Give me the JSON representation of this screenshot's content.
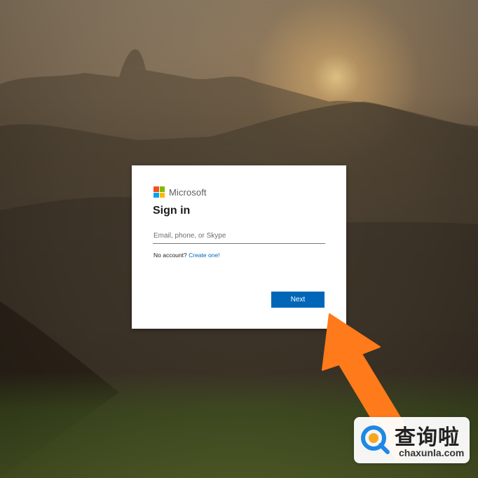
{
  "background": {
    "description_icon": "landscape-photo"
  },
  "dialog": {
    "brand": "Microsoft",
    "title": "Sign in",
    "input_placeholder": "Email, phone, or Skype",
    "input_value": "",
    "no_account_text": "No account?",
    "create_link": "Create one!",
    "next_button": "Next"
  },
  "annotation": {
    "arrow_color": "#ff7a1a",
    "arrow_target": "next-button"
  },
  "watermark": {
    "icon": "magnifier-q-icon",
    "chinese": "查询啦",
    "domain": "chaxunla.com"
  },
  "colors": {
    "ms_red": "#f25022",
    "ms_green": "#7fba00",
    "ms_blue": "#00a4ef",
    "ms_yellow": "#ffb900",
    "primary_button": "#0067b8",
    "link": "#0067b8"
  }
}
